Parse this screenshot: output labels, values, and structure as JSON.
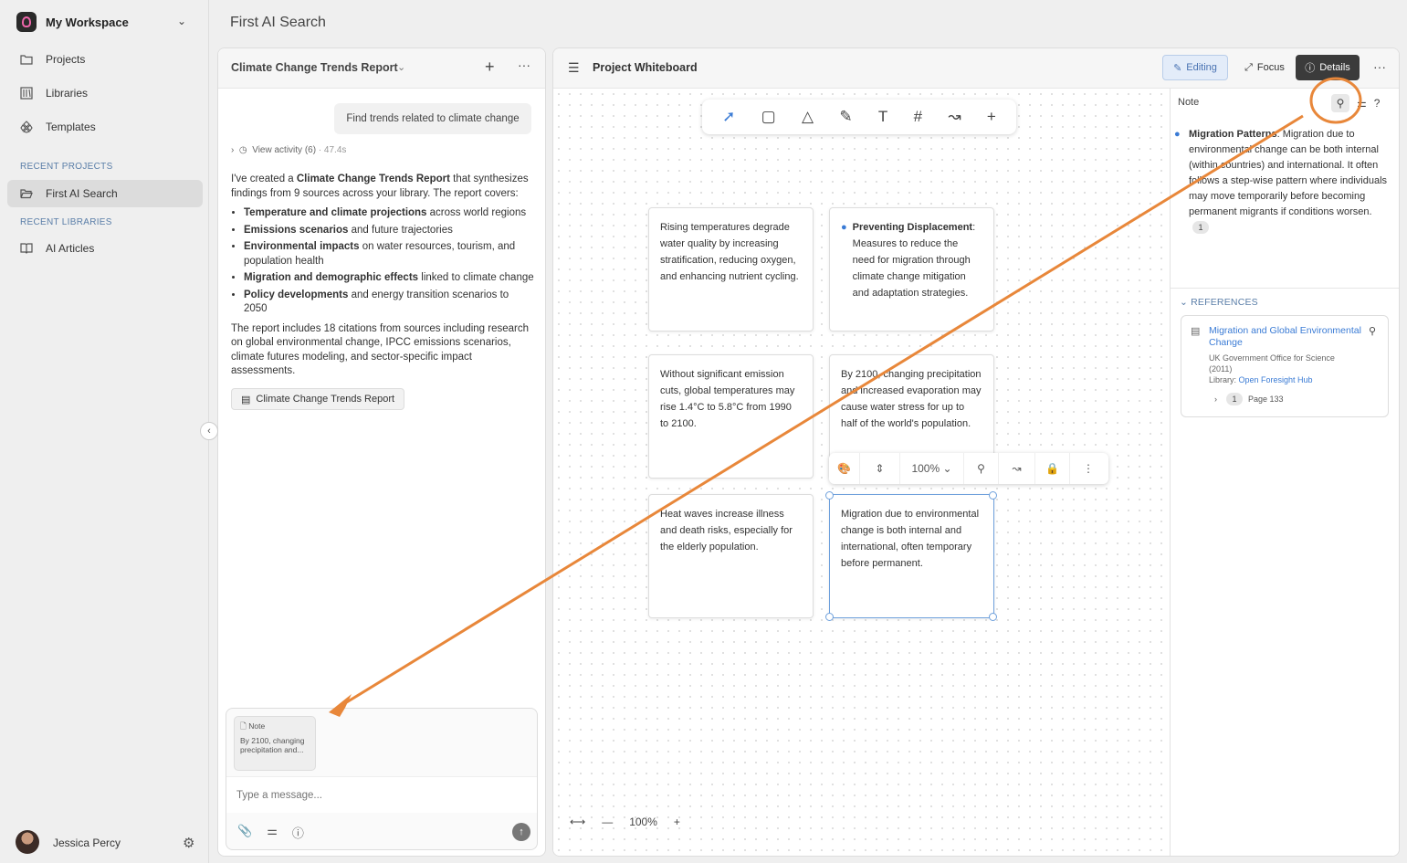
{
  "workspace": {
    "name": "My Workspace"
  },
  "nav": [
    {
      "label": "Projects",
      "icon": "folder-icon"
    },
    {
      "label": "Libraries",
      "icon": "library-icon"
    },
    {
      "label": "Templates",
      "icon": "templates-icon"
    }
  ],
  "recent_projects_label": "RECENT PROJECTS",
  "recent_projects": [
    {
      "label": "First AI Search",
      "icon": "folder-open-icon"
    }
  ],
  "recent_libraries_label": "RECENT LIBRARIES",
  "recent_libraries": [
    {
      "label": "AI Articles",
      "icon": "book-icon"
    }
  ],
  "user": {
    "name": "Jessica Percy"
  },
  "page_title": "First AI Search",
  "chat": {
    "title": "Climate Change Trends Report",
    "user_message": "Find trends related to climate change",
    "activity": "View activity (6)",
    "activity_time": "· 47.4s",
    "reply_intro_1": "I've created a ",
    "reply_intro_bold": "Climate Change Trends Report",
    "reply_intro_2": " that synthesizes findings from 9 sources across your library. The report covers:",
    "bullets": [
      {
        "bold": "Temperature and climate projections",
        "rest": " across world regions"
      },
      {
        "bold": "Emissions scenarios",
        "rest": " and future trajectories"
      },
      {
        "bold": "Environmental impacts",
        "rest": " on water resources, tourism, and population health"
      },
      {
        "bold": "Migration and demographic effects",
        "rest": " linked to climate change"
      },
      {
        "bold": "Policy developments",
        "rest": " and energy transition scenarios to 2050"
      }
    ],
    "reply_outro": "The report includes 18 citations from sources including research on global environmental change, IPCC emissions scenarios, climate futures modeling, and sector-specific impact assessments.",
    "report_chip": "Climate Change Trends Report",
    "attached_note": {
      "label": "Note",
      "text": "By 2100, changing precipitation and..."
    },
    "input_placeholder": "Type a message..."
  },
  "board": {
    "title": "Project Whiteboard",
    "editing_label": "Editing",
    "focus_label": "Focus",
    "details_label": "Details",
    "zoom": "100%",
    "cards": [
      {
        "text": "Rising temperatures degrade water quality by increasing stratification, reducing oxygen, and enhancing nutrient cycling."
      },
      {
        "bold": "Preventing Displacement",
        "text": ": Measures to reduce the need for migration through climate change mitigation and adaptation strategies."
      },
      {
        "text": "Without significant emission cuts, global temperatures may rise 1.4°C to 5.8°C from 1990 to 2100."
      },
      {
        "text": "By 2100, changing precipitation and increased evaporation may cause water stress for up to half of the world's population."
      },
      {
        "text": "Heat waves increase illness and death risks, especially for the elderly population."
      },
      {
        "text": "Migration due to environmental change is both internal and international, often temporary before permanent."
      }
    ],
    "float_zoom": "100%"
  },
  "details": {
    "label": "Note",
    "note_bold": "Migration Patterns",
    "note_text": ": Migration due to environmental change can be both internal (within countries) and international. It often follows a step-wise pattern where individuals may move temporarily before becoming permanent migrants if conditions worsen.",
    "citation": "1",
    "references_label": "REFERENCES",
    "reference": {
      "title": "Migration and Global Environmental Change",
      "author": "UK Government Office for Science",
      "year": "(2011)",
      "library_prefix": "Library: ",
      "library": "Open Foresight Hub",
      "cite_num": "1",
      "page": "Page 133"
    }
  },
  "colors": {
    "accent": "#3a7bd5",
    "annotation": "#e8873a"
  }
}
